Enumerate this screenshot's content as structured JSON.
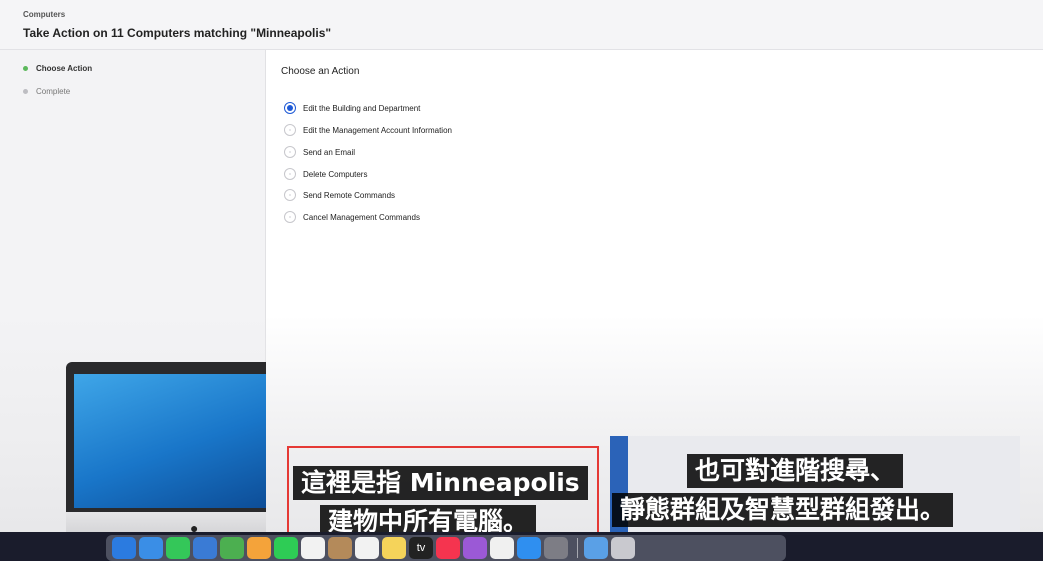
{
  "header": {
    "breadcrumb": "Computers",
    "title": "Take Action on 11 Computers matching \"Minneapolis\""
  },
  "sidebar": {
    "steps": [
      {
        "label": "Choose Action",
        "active": true
      },
      {
        "label": "Complete",
        "active": false
      }
    ]
  },
  "main": {
    "section_title": "Choose an Action",
    "options": [
      {
        "label": "Edit the Building and Department",
        "checked": true
      },
      {
        "label": "Edit the Management Account Information",
        "checked": false
      },
      {
        "label": "Send an Email",
        "checked": false
      },
      {
        "label": "Delete Computers",
        "checked": false
      },
      {
        "label": "Send Remote Commands",
        "checked": false
      },
      {
        "label": "Cancel Management Commands",
        "checked": false
      }
    ]
  },
  "subtitles": {
    "left": [
      "這裡是指 Minneapolis",
      "建物中所有電腦。"
    ],
    "right": [
      "也可對進階搜尋、",
      "靜態群組及智慧型群組發出。"
    ]
  },
  "dock": {
    "icons": [
      {
        "name": "finder-icon",
        "color": "#2b7be0"
      },
      {
        "name": "safari-icon",
        "color": "#3a8ee6"
      },
      {
        "name": "messages-icon",
        "color": "#34c759"
      },
      {
        "name": "mail-icon",
        "color": "#3a7bd5"
      },
      {
        "name": "maps-icon",
        "color": "#4caf50"
      },
      {
        "name": "photos-icon",
        "color": "#f4a33a"
      },
      {
        "name": "facetime-icon",
        "color": "#2ecc55"
      },
      {
        "name": "calendar-icon",
        "color": "#f2f2f2"
      },
      {
        "name": "contacts-icon",
        "color": "#b48a5a"
      },
      {
        "name": "reminders-icon",
        "color": "#f2f2f2"
      },
      {
        "name": "notes-icon",
        "color": "#f5d35a"
      },
      {
        "name": "tv-icon",
        "color": "#222222"
      },
      {
        "name": "music-icon",
        "color": "#f5344f"
      },
      {
        "name": "podcasts-icon",
        "color": "#9b59d6"
      },
      {
        "name": "news-icon",
        "color": "#f0f0f0"
      },
      {
        "name": "app-store-icon",
        "color": "#2f8ff0"
      },
      {
        "name": "system-preferences-icon",
        "color": "#7d7d85"
      },
      {
        "name": "downloads-folder-icon",
        "color": "#5aa0e6"
      },
      {
        "name": "trash-icon",
        "color": "#c9c9cf"
      }
    ],
    "tv_label": "tv"
  }
}
